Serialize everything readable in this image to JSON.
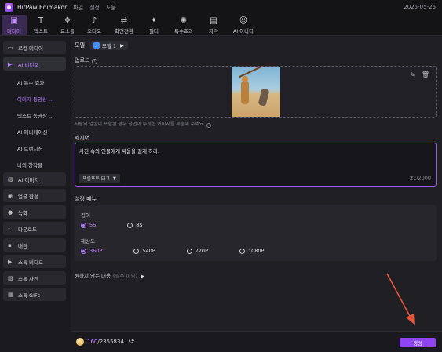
{
  "app": {
    "title": "HitPaw Edimakor",
    "date": "2025-05-26"
  },
  "menu": [
    "파일",
    "설정",
    "도움"
  ],
  "toolbar": [
    {
      "label": "미디어",
      "icon": "media-icon",
      "glyph": "▣",
      "active": true
    },
    {
      "label": "텍스트",
      "icon": "text-icon",
      "glyph": "T",
      "active": false
    },
    {
      "label": "요소들",
      "icon": "elements-icon",
      "glyph": "✥",
      "active": false
    },
    {
      "label": "오디오",
      "icon": "audio-icon",
      "glyph": "♪",
      "active": false
    },
    {
      "label": "화면전환",
      "icon": "transition-icon",
      "glyph": "⇄",
      "active": false
    },
    {
      "label": "필터",
      "icon": "filter-icon",
      "glyph": "✦",
      "active": false
    },
    {
      "label": "특수효과",
      "icon": "effects-icon",
      "glyph": "✺",
      "active": false
    },
    {
      "label": "자막",
      "icon": "subtitle-icon",
      "glyph": "▤",
      "active": false
    },
    {
      "label": "AI 아바타",
      "icon": "avatar-icon",
      "glyph": "☺",
      "active": false
    }
  ],
  "sidebar": {
    "groups_top": [
      {
        "label": "로컬 미디어",
        "icon": "folder-icon",
        "glyph": "▭"
      },
      {
        "label": "AI 비디오",
        "icon": "ai-video-icon",
        "glyph": "▶",
        "active": true
      }
    ],
    "sub_items": [
      {
        "label": "AI 특수 효과"
      },
      {
        "label": "이미지 동영상 ...",
        "active": true
      },
      {
        "label": "텍스트 동영상 ..."
      },
      {
        "label": "AI 애니메이션"
      },
      {
        "label": "AI 트랜지션"
      },
      {
        "label": "나의 창작물"
      }
    ],
    "groups_bottom": [
      {
        "label": "AI 이미지",
        "icon": "ai-image-icon",
        "glyph": "▨"
      },
      {
        "label": "얼굴 합성",
        "icon": "face-icon",
        "glyph": "◉"
      },
      {
        "label": "녹화",
        "icon": "record-icon",
        "glyph": "●"
      },
      {
        "label": "다운로드",
        "icon": "download-icon",
        "glyph": "⤓"
      },
      {
        "label": "배경",
        "icon": "background-icon",
        "glyph": "▪"
      },
      {
        "label": "스톡 비디오",
        "icon": "stock-video-icon",
        "glyph": "▶"
      },
      {
        "label": "스톡 사진",
        "icon": "stock-photo-icon",
        "glyph": "▧"
      },
      {
        "label": "스톡 GIFs",
        "icon": "gif-icon",
        "glyph": "▦"
      }
    ]
  },
  "main": {
    "model_label": "모델",
    "model_value": "모델 1",
    "upload_label": "업로드",
    "upload_hint": "사람의 얼굴이 포함된 경우 정면이 뚜렷한 이미지를 제출해 주세요.",
    "prompt_label": "제시어",
    "prompt_text": "사진 속의 인물에게 싸움을 걸게 하라.",
    "prompt_tag": "프롬프트 태그",
    "prompt_count": "21",
    "prompt_max": "/2000",
    "settings_label": "설정 메뉴",
    "length_label": "길이",
    "length_options": [
      {
        "label": "5S",
        "selected": true
      },
      {
        "label": "8S",
        "selected": false
      }
    ],
    "resolution_label": "해상도",
    "resolution_options": [
      {
        "label": "360P",
        "selected": true
      },
      {
        "label": "540P",
        "selected": false
      },
      {
        "label": "720P",
        "selected": false
      },
      {
        "label": "1080P",
        "selected": false
      }
    ],
    "negative_label": "원하지 않는 내용",
    "negative_optional": "(필수 아님)"
  },
  "bottom": {
    "credits_used": "160",
    "credits_total": "/2355834",
    "generate_label": "생성"
  },
  "colors": {
    "accent": "#8e44f0",
    "accent_text": "#c28bff",
    "annotation_arrow": "#e8553e"
  }
}
